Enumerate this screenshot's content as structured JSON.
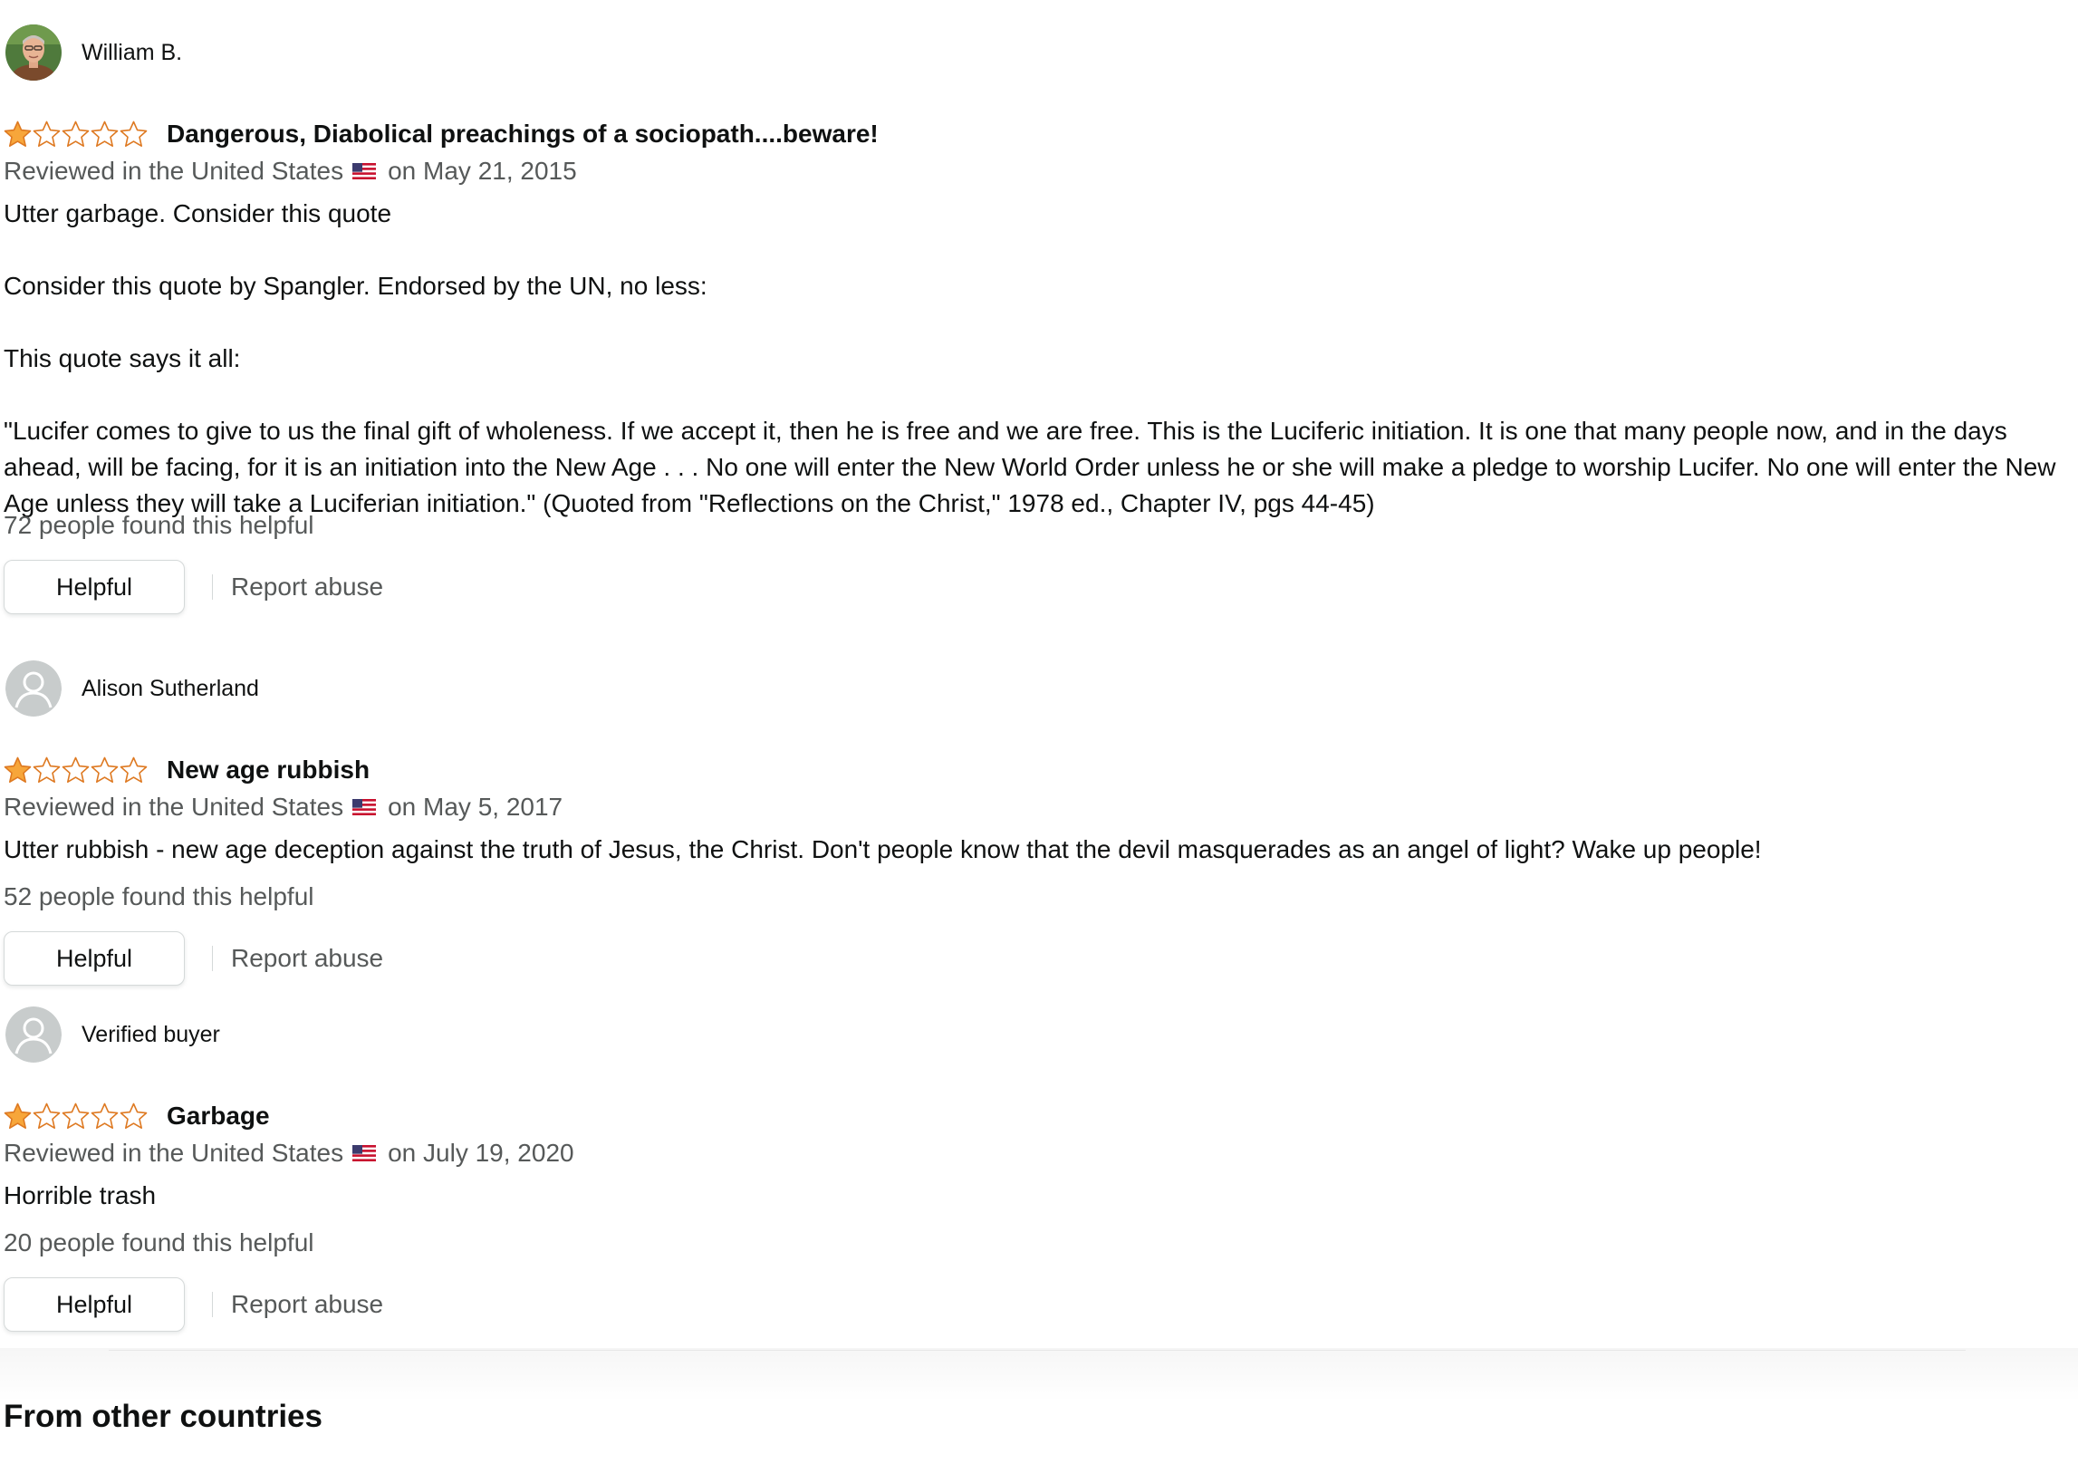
{
  "colors": {
    "star_fill": "#f7a63a",
    "star_outline": "#de7921",
    "text_primary": "#0f1111",
    "text_secondary": "#565959",
    "button_border": "#d5d9d9"
  },
  "reviews": [
    {
      "profile_name": "William B.",
      "avatar_type": "photo",
      "rating": 1,
      "rating_max": 5,
      "title": "Dangerous, Diabolical preachings of a sociopath....beware!",
      "reviewed_in": "Reviewed in the United States",
      "date": "on May 21, 2015",
      "body": [
        "Utter garbage. Consider this quote",
        "Consider this quote by Spangler. Endorsed by the UN, no less:",
        "This quote says it all:",
        "\"Lucifer comes to give to us the final gift of wholeness. If we accept it, then he is free and we are free. This is the Luciferic initiation. It is one that many people now, and in the days ahead, will be facing, for it is an initiation into the New Age . . . No one will enter the New World Order unless he or she will make a pledge to worship Lucifer. No one will enter the New Age unless they will take a Luciferian initiation.\" (Quoted from \"Reflections on the Christ,\" 1978 ed., Chapter IV, pgs 44-45)"
      ],
      "helpful_count": "72 people found this helpful",
      "helpful_label": "Helpful",
      "report_label": "Report abuse"
    },
    {
      "profile_name": "Alison Sutherland",
      "avatar_type": "default-user-icon",
      "rating": 1,
      "rating_max": 5,
      "title": "New age rubbish",
      "reviewed_in": "Reviewed in the United States",
      "date": "on May 5, 2017",
      "body": [
        "Utter rubbish - new age deception against the truth of Jesus, the Christ. Don't people know that the devil masquerades as an angel of light? Wake up people!"
      ],
      "helpful_count": "52 people found this helpful",
      "helpful_label": "Helpful",
      "report_label": "Report abuse"
    },
    {
      "profile_name": "Verified buyer",
      "avatar_type": "default-user-icon",
      "rating": 1,
      "rating_max": 5,
      "title": "Garbage",
      "reviewed_in": "Reviewed in the United States",
      "date": "on July 19, 2020",
      "body": [
        "Horrible trash"
      ],
      "helpful_count": "20 people found this helpful",
      "helpful_label": "Helpful",
      "report_label": "Report abuse"
    }
  ],
  "section_heading": "From other countries"
}
